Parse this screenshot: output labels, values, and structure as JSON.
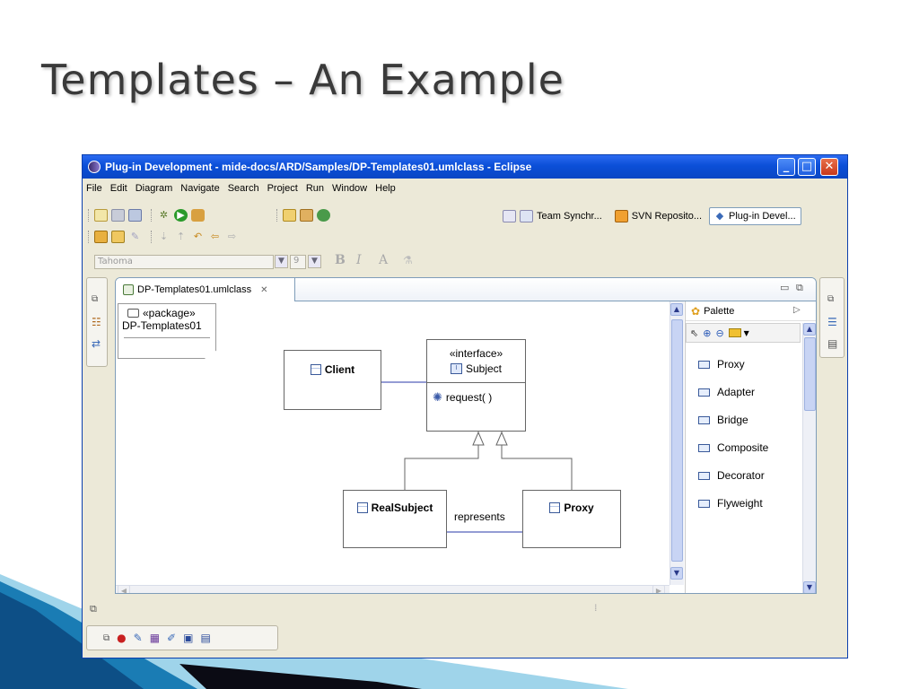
{
  "slide": {
    "title": "Templates – An Example"
  },
  "window": {
    "title": "Plug-in Development - mide-docs/ARD/Samples/DP-Templates01.umlclass - Eclipse",
    "minimize_glyph": "_",
    "maximize_glyph": "□",
    "close_glyph": "✕"
  },
  "menu": [
    "File",
    "Edit",
    "Diagram",
    "Navigate",
    "Search",
    "Project",
    "Run",
    "Window",
    "Help"
  ],
  "perspectives": {
    "team_sync": "Team Synchr...",
    "svn_repo": "SVN Reposito...",
    "plugin_dev": "Plug-in Devel..."
  },
  "format_bar": {
    "font_name": "Tahoma",
    "font_size": "9",
    "bold": "B",
    "italic": "I",
    "font_color": "A"
  },
  "editor": {
    "tab_label": "DP-Templates01.umlclass",
    "tab_close": "✕"
  },
  "diagram": {
    "package_stereotype": "«package»",
    "package_name": "DP-Templates01",
    "client": "Client",
    "interface_stereotype": "«interface»",
    "subject": "Subject",
    "operation": "request( )",
    "real_subject": "RealSubject",
    "proxy": "Proxy",
    "association_label": "represents"
  },
  "palette": {
    "title": "Palette",
    "items": [
      "Proxy",
      "Adapter",
      "Bridge",
      "Composite",
      "Decorator",
      "Flyweight"
    ]
  },
  "colors": {
    "titlebar": "#0b4fd8",
    "accent_blue": "#1a5ba8",
    "association_line": "#2a3aa8"
  }
}
